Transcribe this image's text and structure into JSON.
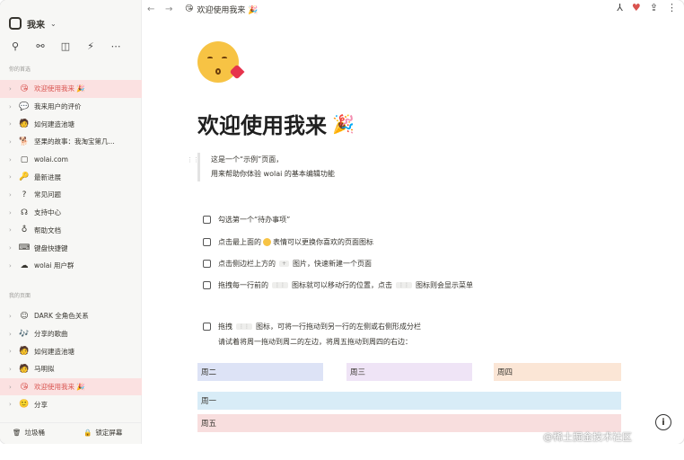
{
  "workspace": {
    "name": "我来"
  },
  "sidebar": {
    "section1_title": "你的首选",
    "section2_title": "我的页面",
    "items1": [
      {
        "icon": "😘",
        "label": "欢迎使用我来 🎉"
      },
      {
        "icon": "💬",
        "label": "我来用户的评价"
      },
      {
        "icon": "🧑",
        "label": "如何建造池塘"
      },
      {
        "icon": "🐕",
        "label": "坚果的故事：我淘宝第几..."
      },
      {
        "icon": "▢",
        "label": "wolai.com"
      },
      {
        "icon": "🔑",
        "label": "最新进展"
      },
      {
        "icon": "?",
        "label": "常见问题"
      },
      {
        "icon": "☊",
        "label": "支持中心"
      },
      {
        "icon": "♁",
        "label": "帮助文档"
      },
      {
        "icon": "⌨",
        "label": "键盘快捷键"
      },
      {
        "icon": "☁",
        "label": "wolai 用户群"
      }
    ],
    "items2": [
      {
        "icon": "☺",
        "label": "DARK 全角色关系"
      },
      {
        "icon": "🎶",
        "label": "分享的歌曲"
      },
      {
        "icon": "🧑",
        "label": "如何建造池塘"
      },
      {
        "icon": "🧑",
        "label": "马明拟"
      },
      {
        "icon": "😘",
        "label": "欢迎使用我来 🎉"
      },
      {
        "icon": "🙂",
        "label": "分享"
      }
    ],
    "footer": {
      "trash": "垃圾桶",
      "lock": "锁定屏幕"
    }
  },
  "topbar": {
    "crumb": "欢迎使用我来 🎉"
  },
  "page": {
    "title": "欢迎使用我来",
    "title_emoji": "🎉",
    "quote_line1": "这是一个“示例”页面，",
    "quote_line2": "用来帮助你体验 wolai 的基本编辑功能",
    "todos": [
      "勾选第一个“待办事项”",
      "点击最上面的",
      "点击侧边栏上方的",
      "拖拽每一行前的"
    ],
    "todo2_rest": "表情可以更换你喜欢的页面图标",
    "todo3_rest": "图片，快速新建一个页面",
    "todo4_rest": "图标就可以移动行的位置，点击",
    "todo4_tail": "图标则会显示菜单",
    "drag_start": "拖拽",
    "drag_rest": "图标，可将一行拖动到另一行的左侧或右侧形成分栏",
    "drag_line2": "请试着将周一拖动到周二的左边，将周五拖动到周四的右边：",
    "chip": "⋮⋮",
    "chip_plus": "+",
    "columns": [
      "周二",
      "周三",
      "周四"
    ],
    "rows": [
      "周一",
      "周五"
    ],
    "help": "i"
  },
  "watermark": "@稀土掘金技术社区"
}
